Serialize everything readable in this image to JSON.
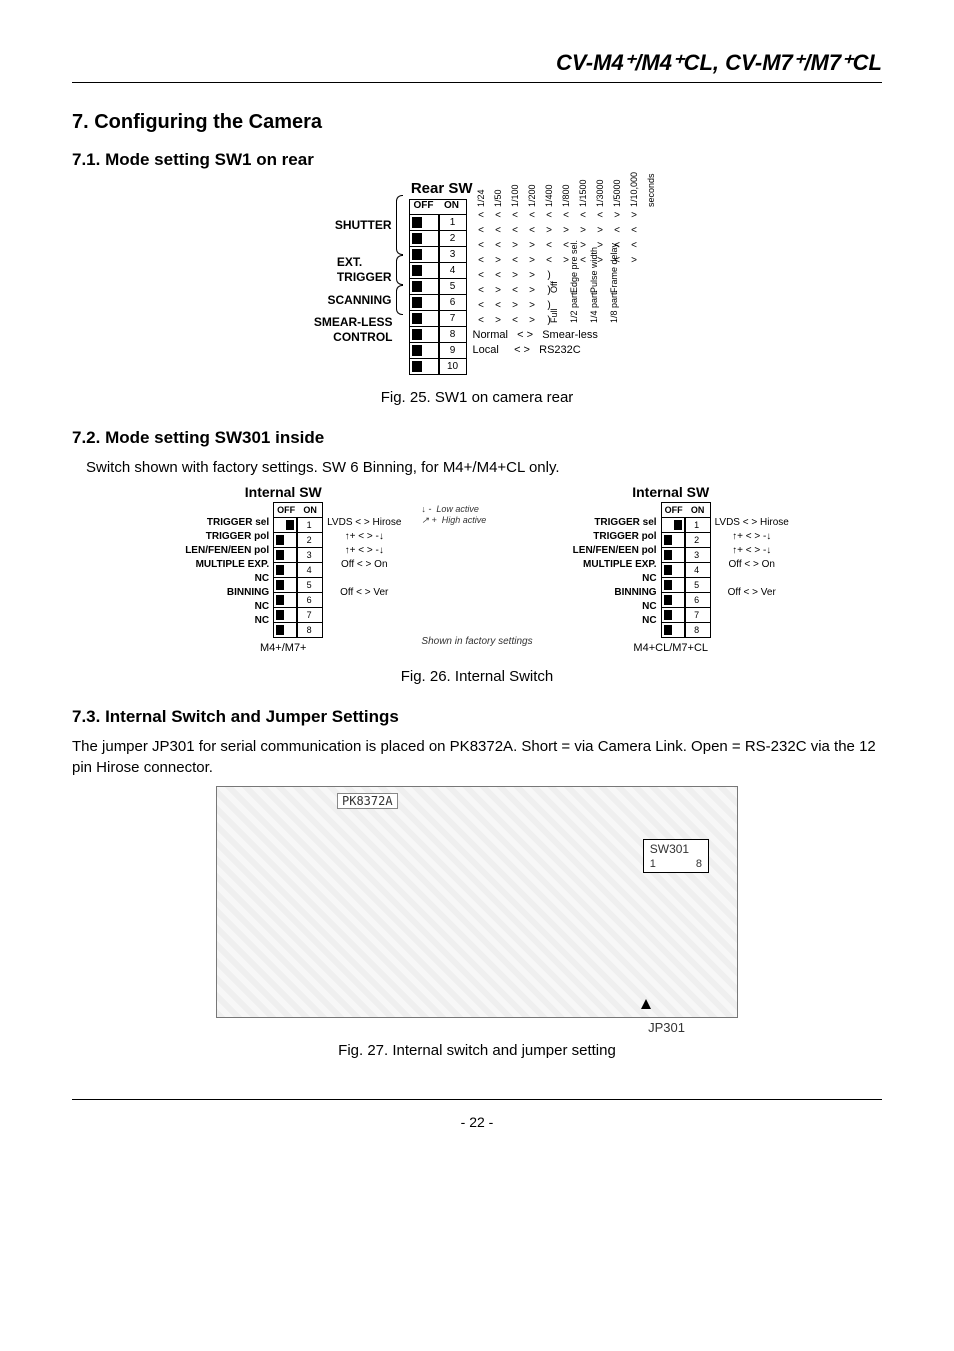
{
  "page_header": "CV-M4⁺/M4⁺CL, CV-M7⁺/M7⁺CL",
  "sec7_title": "7. Configuring the Camera",
  "sec71_title": "7.1. Mode setting SW1 on rear",
  "sec72_title": "7.2. Mode setting SW301 inside",
  "sec72_body": "Switch shown with factory settings. SW 6 Binning, for M4+/M4+CL only.",
  "sec73_title": "7.3. Internal Switch and Jumper Settings",
  "sec73_body": "The jumper JP301 for serial communication is placed on PK8372A. Short = via Camera Link. Open = RS-232C via the 12 pin Hirose connector.",
  "fig25": "Fig. 25. SW1 on camera rear",
  "fig26": "Fig. 26. Internal Switch",
  "fig27": "Fig. 27. Internal switch and jumper setting",
  "page_num": "- 22 -",
  "rear": {
    "title": "Rear SW",
    "off": "OFF",
    "on": "ON",
    "left_labels": {
      "shutter": "SHUTTER",
      "ext_trigger_1": "EXT.",
      "ext_trigger_2": "TRIGGER",
      "scanning": "SCANNING",
      "smearless": "SMEAR-LESS",
      "control": "CONTROL"
    },
    "sw_numbers": [
      "1",
      "2",
      "3",
      "4",
      "5",
      "6",
      "7",
      "8",
      "9",
      "10"
    ],
    "col_heads": [
      "1/24",
      "1/50",
      "1/100",
      "1/200",
      "1/400",
      "1/800",
      "1/1500",
      "1/3000",
      "1/5000",
      "1/10,000",
      "seconds"
    ],
    "shutter_matrix": [
      [
        "<",
        "<",
        "<",
        "<",
        "<",
        "<",
        "<",
        "<",
        ">",
        ">"
      ],
      [
        "<",
        "<",
        "<",
        "<",
        ">",
        ">",
        ">",
        ">",
        "<",
        "<"
      ],
      [
        "<",
        "<",
        ">",
        ">",
        "<",
        "<",
        ">",
        ">",
        "<",
        "<"
      ],
      [
        "<",
        ">",
        "<",
        ">",
        "<",
        ">",
        "<",
        ">",
        "<",
        ">"
      ]
    ],
    "ext_sw": [
      [
        "<",
        "<",
        ">",
        ">"
      ],
      [
        "<",
        ">",
        "<",
        ">"
      ]
    ],
    "ext_labels": [
      "Off",
      "Edge pre sel.",
      "Pulse width",
      "Frame delay"
    ],
    "scan_sw": [
      [
        "<",
        "<",
        ">",
        ">"
      ],
      [
        "<",
        ">",
        "<",
        ">"
      ]
    ],
    "scan_labels": [
      "Full",
      "1/2 part.",
      "1/4 part.",
      "1/8 part."
    ],
    "smear_row": {
      "left": "Normal",
      "rel": "< >",
      "right": "Smear-less"
    },
    "control_row": {
      "left": "Local",
      "rel": "< >",
      "right": "RS232C"
    }
  },
  "internal": {
    "title": "Internal SW",
    "off": "OFF",
    "on": "ON",
    "legend_low": "Low active",
    "legend_high": "High active",
    "rows_labels": [
      "TRIGGER sel",
      "TRIGGER pol",
      "LEN/FEN/EEN pol",
      "MULTIPLE EXP.",
      "NC",
      "BINNING",
      "NC",
      "NC"
    ],
    "right_labels": [
      "LVDS  < >  Hirose",
      "↑+  < >  -↓",
      "↑+  < >  -↓",
      "Off  < >  On",
      "",
      "Off  < >  Ver",
      "",
      ""
    ],
    "positions_left": [
      "on",
      "off",
      "off",
      "off",
      "off",
      "off",
      "off",
      "off"
    ],
    "positions_right": [
      "on",
      "off",
      "off",
      "off",
      "off",
      "off",
      "off",
      "off"
    ],
    "footer_left": "M4+/M7+",
    "footer_right": "M4+CL/M7+CL",
    "footnote": "Shown in factory settings"
  },
  "board": {
    "chip": "PK8372A",
    "sw301": "SW301",
    "sw301_n1": "1",
    "sw301_n8": "8",
    "jp301": "JP301"
  }
}
